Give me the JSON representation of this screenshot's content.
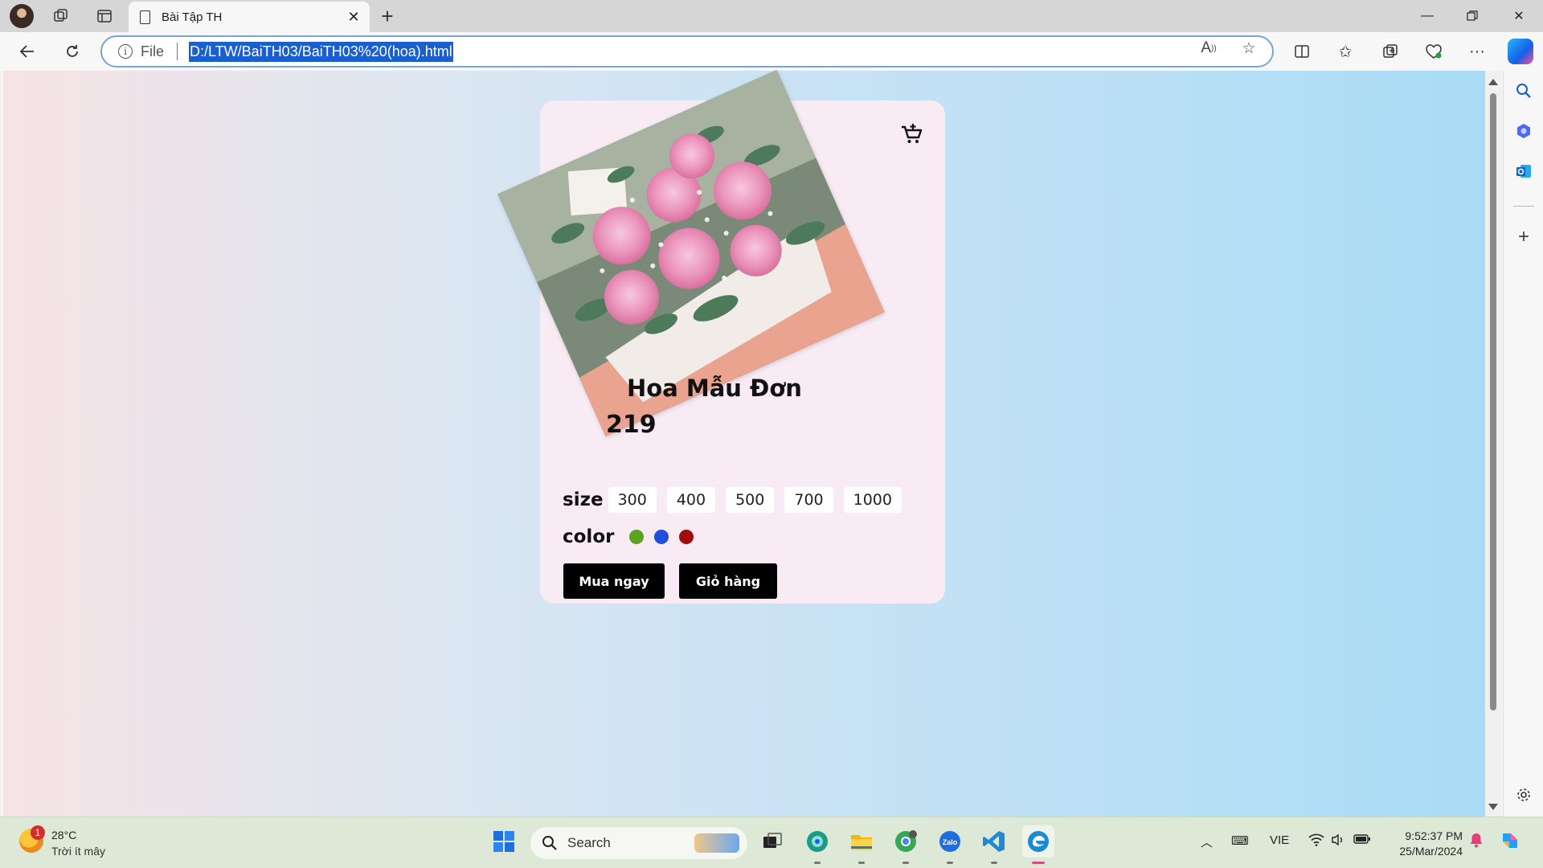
{
  "browser": {
    "tab_title": "Bài Tập TH",
    "address_scheme": "File",
    "address_url": "D:/LTW/BaiTH03/BaiTH03%20(hoa).html"
  },
  "product": {
    "name": "Hoa Mẫu Đơn",
    "price": "219",
    "size_label": "size",
    "sizes": [
      "300",
      "400",
      "500",
      "700",
      "1000"
    ],
    "color_label": "color",
    "colors": [
      "#5aa21f",
      "#1f4fd8",
      "#a30c0c"
    ],
    "buy_now_label": "Mua ngay",
    "cart_label": "Giỏ hàng"
  },
  "taskbar": {
    "weather_badge": "1",
    "weather_temp": "28°C",
    "weather_desc": "Trời ít mây",
    "search_label": "Search",
    "language": "VIE",
    "time": "9:52:37 PM",
    "date": "25/Mar/2024"
  },
  "icons": {
    "profile": "avatar",
    "workspaces": "workspaces-icon",
    "vertical_tabs": "tab-actions-icon",
    "cart": "shopping-cart-icon"
  }
}
